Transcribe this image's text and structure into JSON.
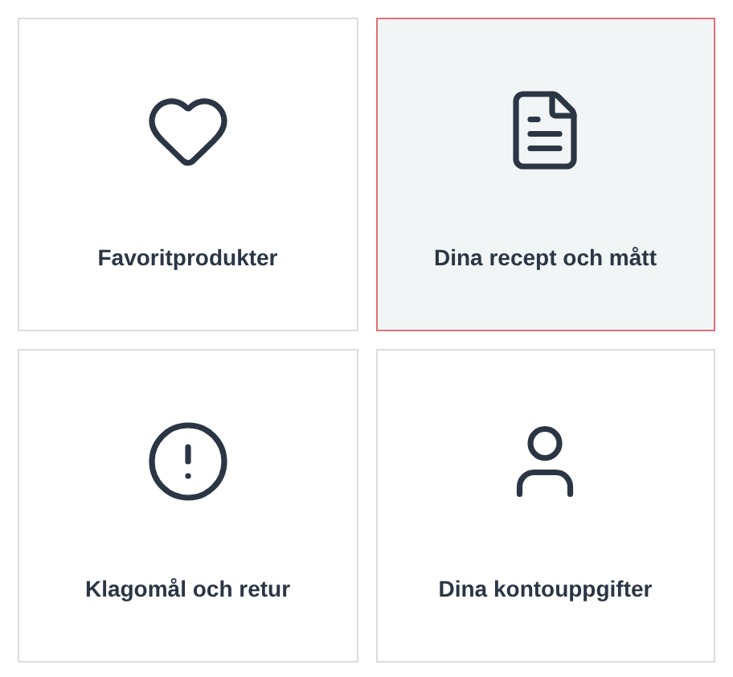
{
  "cards": [
    {
      "label": "Favoritprodukter",
      "kind": "heart",
      "selected": false
    },
    {
      "label": "Dina recept och mått",
      "kind": "document",
      "selected": true
    },
    {
      "label": "Klagomål och retur",
      "kind": "alert",
      "selected": false
    },
    {
      "label": "Dina kontouppgifter",
      "kind": "user",
      "selected": false
    }
  ]
}
